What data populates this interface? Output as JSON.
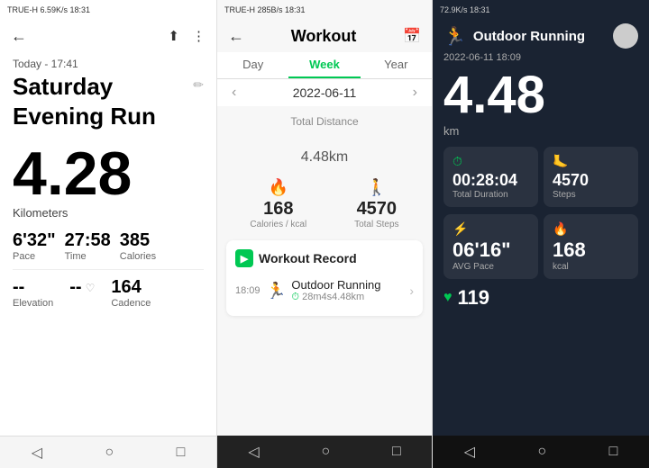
{
  "panel1": {
    "statusbar": "TRUE-H  6.59K/s  18:31",
    "today_label": "Today - 17:41",
    "title_line1": "Saturday",
    "title_line2": "Evening Run",
    "distance": "4.28",
    "unit": "Kilometers",
    "pace_val": "6'32\"",
    "pace_label": "Pace",
    "time_val": "27:58",
    "time_label": "Time",
    "calories_val": "385",
    "calories_label": "Calories",
    "elevation_val": "--",
    "elevation_label": "Elevation",
    "avg_val": "--",
    "avg_label": "",
    "cadence_val": "164",
    "cadence_label": "Cadence"
  },
  "panel2": {
    "statusbar": "TRUE-H  285B/s  18:31",
    "title": "Workout",
    "tabs": [
      "Day",
      "Week",
      "Year"
    ],
    "active_tab": "Week",
    "date": "2022-06-11",
    "total_distance_label": "Total Distance",
    "total_distance": "4.48",
    "total_distance_unit": "km",
    "calories_val": "168",
    "calories_label": "Calories / kcal",
    "steps_val": "4570",
    "steps_label": "Total Steps",
    "record_section_title": "Workout Record",
    "workout_time": "18:09",
    "workout_name": "Outdoor Running",
    "workout_detail": "28m4s4.48km"
  },
  "panel3": {
    "statusbar": "72.9K/s  18:31",
    "activity_type": "Outdoor Running",
    "date": "2022-06-11 18:09",
    "distance": "4.48",
    "distance_unit": "km",
    "duration_val": "00:28:04",
    "duration_label": "Total Duration",
    "steps_val": "4570",
    "steps_label": "Steps",
    "pace_val": "06'16\"",
    "pace_label": "AVG Pace",
    "kcal_val": "168",
    "kcal_label": "kcal",
    "heart_val": "119",
    "heart_label": "Heart Rate"
  },
  "nav": {
    "back": "◁",
    "home": "○",
    "square": "□"
  }
}
